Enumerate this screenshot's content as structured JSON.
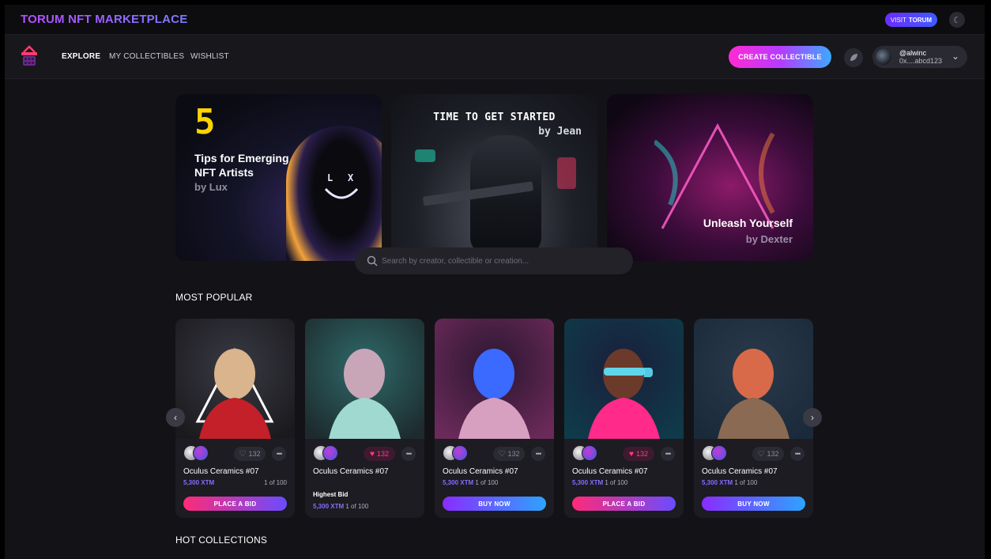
{
  "topbar": {
    "brand": "TORUM NFT MARKETPLACE",
    "visit_prefix": "VISIT",
    "visit_brand": "TORUM",
    "theme_icon": "moon-icon"
  },
  "nav": {
    "logo_icon": "basket-icon",
    "links": [
      "EXPLORE",
      "MY COLLECTIBLES",
      "WISHLIST"
    ],
    "create_label": "CREATE COLLECTIBLE",
    "notification_icon": "leaf-icon",
    "user": {
      "handle": "@alwinc",
      "address": "0x....abcd123",
      "chevron": "chevron-down-icon"
    }
  },
  "banners": [
    {
      "number": "5",
      "title": "Tips for Emerging NFT Artists",
      "by": "by Lux"
    },
    {
      "title": "TIME TO GET STARTED",
      "by": "by Jean"
    },
    {
      "title": "Unleash Yourself",
      "by": "by Dexter"
    }
  ],
  "search": {
    "placeholder": "Search by creator, collectible or creation..."
  },
  "sections": {
    "most_popular": "MOST POPULAR",
    "hot_collections": "HOT COLLECTIONS"
  },
  "cards": [
    {
      "title": "Oculus Ceramics #07",
      "likes": "132",
      "liked": false,
      "price": "5,300 XTM",
      "edition": "1 of 100",
      "cta": "PLACE A BID",
      "cta_style": "bid"
    },
    {
      "title": "Oculus Ceramics #07",
      "likes": "132",
      "liked": true,
      "highest_label": "Highest Bid",
      "price": "5,300 XTM",
      "edition": "1 of 100"
    },
    {
      "title": "Oculus Ceramics #07",
      "likes": "132",
      "liked": false,
      "price": "5,300 XTM",
      "edition": "1 of 100",
      "cta": "BUY NOW",
      "cta_style": "buy"
    },
    {
      "title": "Oculus Ceramics #07",
      "likes": "132",
      "liked": true,
      "price": "5,300 XTM",
      "edition": "1 of 100",
      "cta": "PLACE A BID",
      "cta_style": "bid"
    },
    {
      "title": "Oculus Ceramics #07",
      "likes": "132",
      "liked": false,
      "price": "5,300 XTM",
      "edition": "1 of 100",
      "cta": "BUY NOW",
      "cta_style": "buy"
    }
  ],
  "colors": {
    "accent_purple": "#8a6bff",
    "accent_pink": "#ff2a78",
    "accent_blue": "#2da3ff",
    "background": "#131317"
  }
}
